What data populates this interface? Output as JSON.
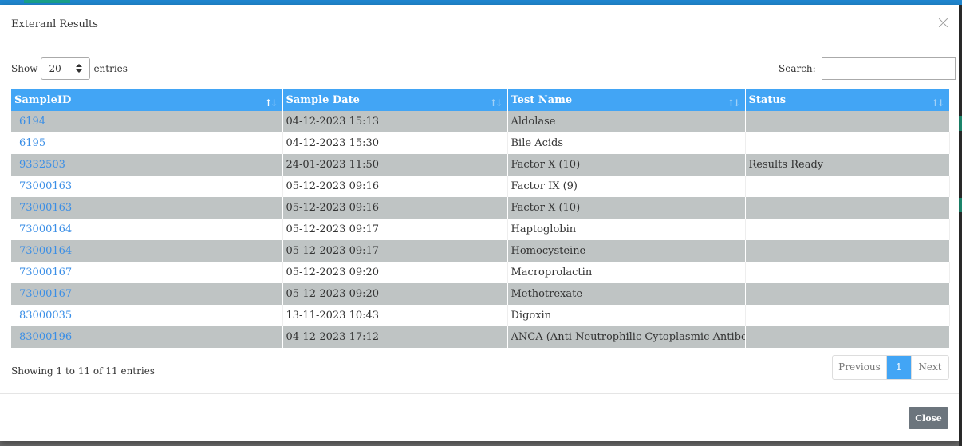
{
  "modal": {
    "title": "Exteranl Results",
    "close_icon": "close-icon"
  },
  "length": {
    "show_label": "Show",
    "value": "20",
    "entries_label": "entries"
  },
  "search": {
    "label": "Search:",
    "value": ""
  },
  "table": {
    "columns": [
      "SampleID",
      "Sample Date",
      "Test Name",
      "Status"
    ],
    "sort_icon": "sort-arrows-icon",
    "rows": [
      {
        "id": "6194",
        "date": "04-12-2023 15:13",
        "test": "Aldolase",
        "status": ""
      },
      {
        "id": "6195",
        "date": "04-12-2023 15:30",
        "test": "Bile Acids",
        "status": ""
      },
      {
        "id": "9332503",
        "date": "24-01-2023 11:50",
        "test": "Factor X (10)",
        "status": "Results Ready"
      },
      {
        "id": "73000163",
        "date": "05-12-2023 09:16",
        "test": "Factor IX (9)",
        "status": ""
      },
      {
        "id": "73000163",
        "date": "05-12-2023 09:16",
        "test": "Factor X (10)",
        "status": ""
      },
      {
        "id": "73000164",
        "date": "05-12-2023 09:17",
        "test": "Haptoglobin",
        "status": ""
      },
      {
        "id": "73000164",
        "date": "05-12-2023 09:17",
        "test": "Homocysteine",
        "status": ""
      },
      {
        "id": "73000167",
        "date": "05-12-2023 09:20",
        "test": "Macroprolactin",
        "status": ""
      },
      {
        "id": "73000167",
        "date": "05-12-2023 09:20",
        "test": "Methotrexate",
        "status": ""
      },
      {
        "id": "83000035",
        "date": "13-11-2023 10:43",
        "test": "Digoxin",
        "status": ""
      },
      {
        "id": "83000196",
        "date": "04-12-2023 17:12",
        "test": "ANCA (Anti Neutrophilic Cytoplasmic Antibody)",
        "status": ""
      }
    ]
  },
  "info": "Showing 1 to 11 of 11 entries",
  "pagination": {
    "previous": "Previous",
    "current": "1",
    "next": "Next"
  },
  "footer": {
    "close_label": "Close"
  },
  "colors": {
    "header_blue": "#42a5f5",
    "link_blue": "#3a8ee6",
    "odd_row": "#bfc4c4",
    "close_button": "#6c757d"
  }
}
